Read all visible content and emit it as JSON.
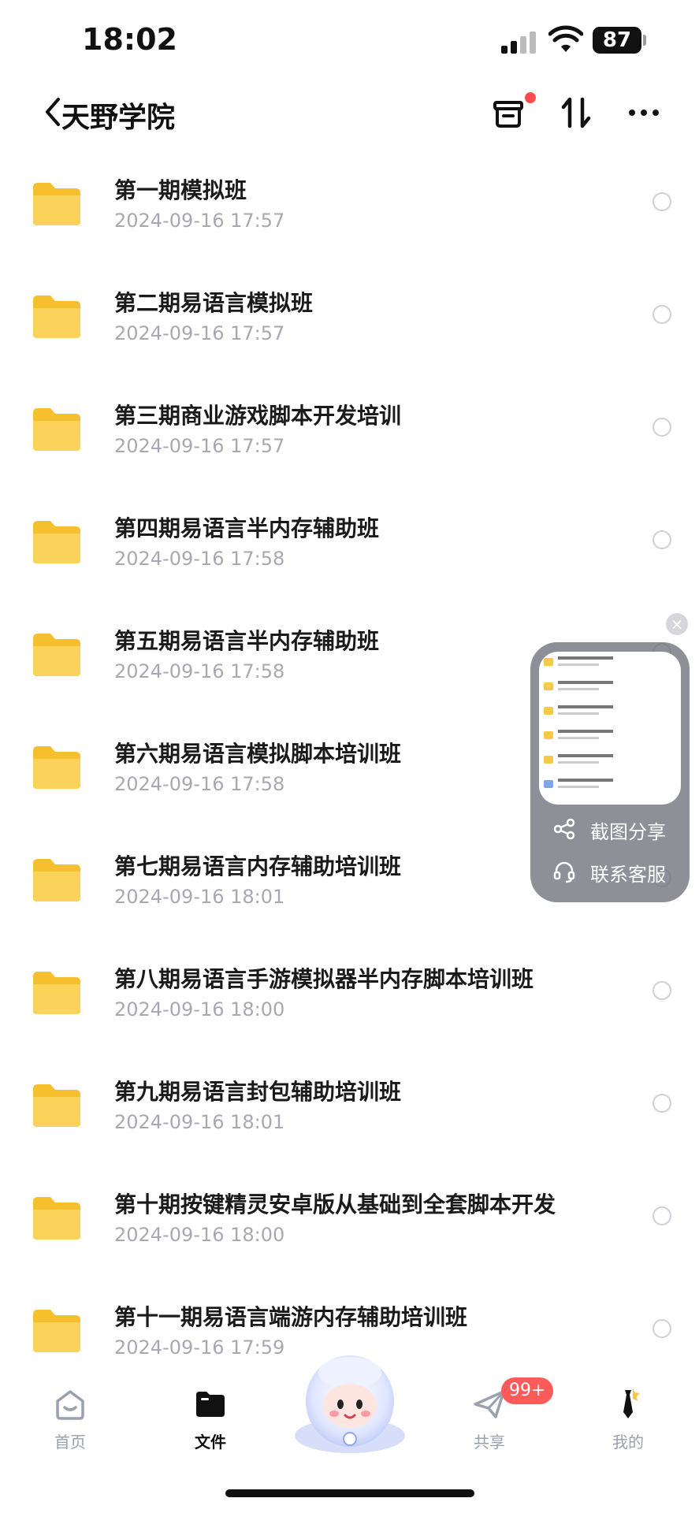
{
  "status_bar": {
    "time": "18:02",
    "battery": "87"
  },
  "header": {
    "title": "天野学院"
  },
  "files": [
    {
      "name": "第一期模拟班",
      "date": "2024-09-16 17:57"
    },
    {
      "name": "第二期易语言模拟班",
      "date": "2024-09-16 17:57"
    },
    {
      "name": "第三期商业游戏脚本开发培训",
      "date": "2024-09-16 17:57"
    },
    {
      "name": "第四期易语言半内存辅助班",
      "date": "2024-09-16 17:58"
    },
    {
      "name": "第五期易语言半内存辅助班",
      "date": "2024-09-16 17:58"
    },
    {
      "name": "第六期易语言模拟脚本培训班",
      "date": "2024-09-16 17:58"
    },
    {
      "name": "第七期易语言内存辅助培训班",
      "date": "2024-09-16 18:01"
    },
    {
      "name": "第八期易语言手游模拟器半内存脚本培训班",
      "date": "2024-09-16 18:00"
    },
    {
      "name": "第九期易语言封包辅助培训班",
      "date": "2024-09-16 18:01"
    },
    {
      "name": "第十期按键精灵安卓版从基础到全套脚本开发",
      "date": "2024-09-16 18:00"
    },
    {
      "name": "第十一期易语言端游内存辅助培训班",
      "date": "2024-09-16 17:59"
    }
  ],
  "floating_panel": {
    "share_label": "截图分享",
    "support_label": "联系客服",
    "close_symbol": "×"
  },
  "tabbar": {
    "home": "首页",
    "files": "文件",
    "share": "共享",
    "mine": "我的",
    "share_badge": "99+"
  },
  "colors": {
    "folder": "#f7c948",
    "badge": "#ff5a5a",
    "accent_dot": "#ff4d4f"
  }
}
